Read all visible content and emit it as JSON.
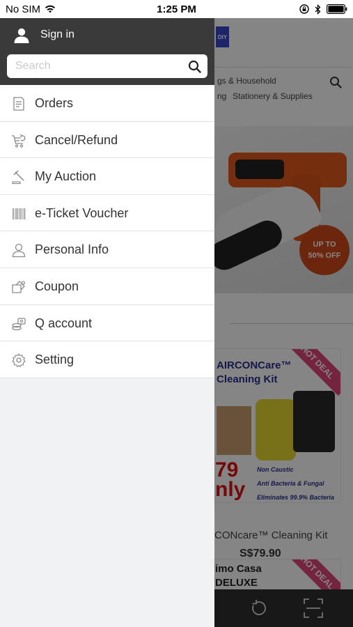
{
  "status_bar": {
    "carrier": "No SIM",
    "time": "1:25 PM"
  },
  "drawer": {
    "sign_in_label": "Sign in",
    "search_placeholder": "Search",
    "menu_items": [
      {
        "label": "Orders",
        "icon": "orders-icon"
      },
      {
        "label": "Cancel/Refund",
        "icon": "cart-refund-icon"
      },
      {
        "label": "My Auction",
        "icon": "gavel-icon"
      },
      {
        "label": "e-Ticket Voucher",
        "icon": "barcode-icon"
      },
      {
        "label": "Personal Info",
        "icon": "person-icon"
      },
      {
        "label": "Coupon",
        "icon": "coupon-icon"
      },
      {
        "label": "Q account",
        "icon": "q-account-icon"
      },
      {
        "label": "Setting",
        "icon": "gear-icon"
      }
    ]
  },
  "background": {
    "logo_text": "DIY",
    "categories_line1": "gs & Household",
    "categories_line2a": "ng",
    "categories_line2b": "Stationery & Supplies",
    "banner_badge_line1": "UP TO",
    "banner_badge_line2": "50% OFF",
    "card1_title_line1": "AIRCONCare™",
    "card1_title_line2": "Cleaning Kit",
    "card1_hot_label": "HOT DEAL",
    "card1_price_big": "79",
    "card1_price_big_2": "nly",
    "card1_feature_1": "Non Caustic",
    "card1_feature_2": "Anti Bacteria & Fungal",
    "card1_feature_3": "Eliminates 99.9% Bacteria",
    "product_name": "CONcare™ Cleaning Kit",
    "product_price": "S$79.90",
    "card2_title_line1": "imo Casa",
    "card2_title_line2": "DELUXE",
    "card2_hot_label": "HOT DEAL"
  },
  "colors": {
    "drawer_header_bg": "#3a3a3a",
    "drawer_bg": "#f1f2f4",
    "menu_text": "#333333",
    "logo_bg": "#3848c8",
    "price_red": "#e01010",
    "hot_deal_pink": "#e0457b"
  }
}
